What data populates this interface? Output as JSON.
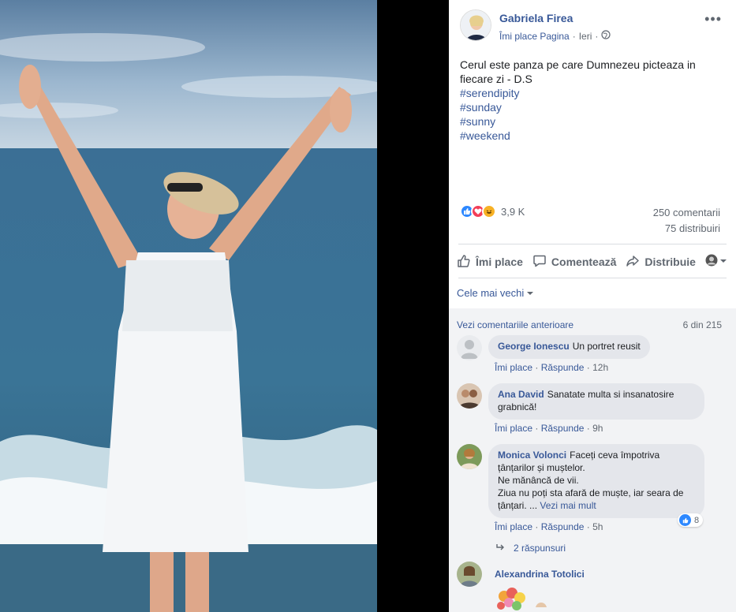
{
  "post": {
    "author": "Gabriela Firea",
    "like_page": "Îmi place Pagina",
    "separator": "·",
    "time": "Ieri",
    "text_line1": "Cerul este panza pe care Dumnezeu picteaza in fiecare zi - D.S",
    "hashtags": [
      "#serendipity",
      "#sunday",
      "#sunny",
      "#weekend"
    ],
    "more_icon": "more-horizontal-icon",
    "privacy_icon": "globe-icon"
  },
  "stats": {
    "reactions_count": "3,9 K",
    "comments": "250 comentarii",
    "shares": "75 distribuiri",
    "reaction_types": [
      "like",
      "love",
      "haha"
    ]
  },
  "actions": {
    "like": "Îmi place",
    "comment": "Comentează",
    "share": "Distribuie"
  },
  "comments_section": {
    "sort_label": "Cele mai vechi",
    "view_previous": "Vezi comentariile anterioare",
    "count": "6 din 215",
    "like_label": "Îmi place",
    "reply_label": "Răspunde",
    "items": [
      {
        "author": "George Ionescu",
        "text": "Un portret reusit",
        "time": "12h"
      },
      {
        "author": "Ana David",
        "text": "Sanatate multa si insanatosire grabnică!",
        "time": "9h"
      },
      {
        "author": "Monica Volonci",
        "text_line1": "Faceți ceva împotriva",
        "text_line2": "țânțarilor și muștelor.",
        "text_line3": "Ne mănâncă de vii.",
        "text_line4": "Ziua nu poți sta afară de muște, iar seara de",
        "text_line5": "țânțari. ...",
        "see_more": "Vezi mai mult",
        "time": "5h",
        "likes": "8"
      },
      {
        "author": "Alexandrina Totolici"
      }
    ],
    "replies": "2 răspunsuri"
  },
  "colors": {
    "link": "#385898",
    "muted": "#606770",
    "bubble": "#e4e6eb",
    "like_blue": "#2d88ff",
    "love_red": "#f33e58",
    "haha_yellow": "#f7b125"
  }
}
